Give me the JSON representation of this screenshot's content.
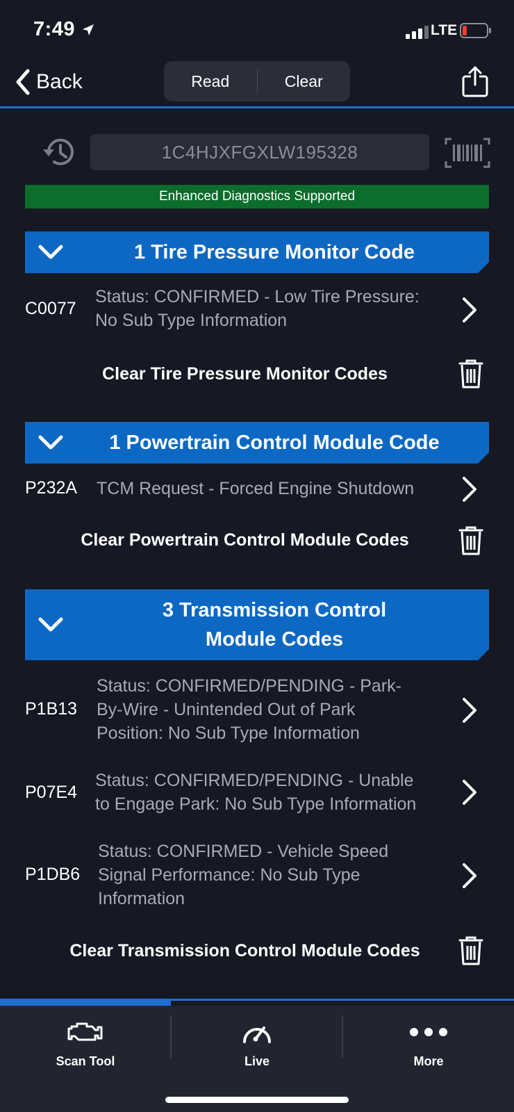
{
  "status_bar": {
    "time": "7:49",
    "network": "LTE"
  },
  "nav": {
    "back_label": "Back",
    "segments": [
      "Read",
      "Clear"
    ]
  },
  "vin": {
    "value": "1C4HJXFGXLW195328"
  },
  "banner": {
    "text": "Enhanced Diagnostics Supported",
    "color": "#0c6d2c"
  },
  "accent_color": "#0d68c4",
  "sections": [
    {
      "title": "1 Tire Pressure Monitor Code",
      "codes": [
        {
          "code": "C0077",
          "line1": "Status: CONFIRMED - Low Tire Pressure:",
          "line2": "No Sub Type Information"
        }
      ],
      "clear_label": "Clear Tire Pressure Monitor Codes"
    },
    {
      "title": "1 Powertrain Control Module Code",
      "codes": [
        {
          "code": "P232A",
          "line1": "TCM Request - Forced Engine Shutdown"
        }
      ],
      "clear_label": "Clear Powertrain Control Module Codes"
    },
    {
      "title_line1": "3 Transmission Control",
      "title_line2": "Module Codes",
      "codes": [
        {
          "code": "P1B13",
          "line1": "Status: CONFIRMED/PENDING - Park-",
          "line2": "By-Wire - Unintended Out of Park",
          "line3": "Position: No Sub Type Information"
        },
        {
          "code": "P07E4",
          "line1": "Status: CONFIRMED/PENDING - Unable",
          "line2": "to Engage Park: No Sub Type Information"
        },
        {
          "code": "P1DB6",
          "line1": "Status: CONFIRMED - Vehicle Speed",
          "line2": "Signal Performance: No Sub Type",
          "line3": "Information"
        }
      ],
      "clear_label": "Clear Transmission Control Module Codes"
    }
  ],
  "tab_bar": {
    "tabs": [
      {
        "label": "Scan Tool",
        "icon": "engine-icon"
      },
      {
        "label": "Live",
        "icon": "gauge-icon"
      },
      {
        "label": "More",
        "icon": "more-dots-icon"
      }
    ]
  }
}
